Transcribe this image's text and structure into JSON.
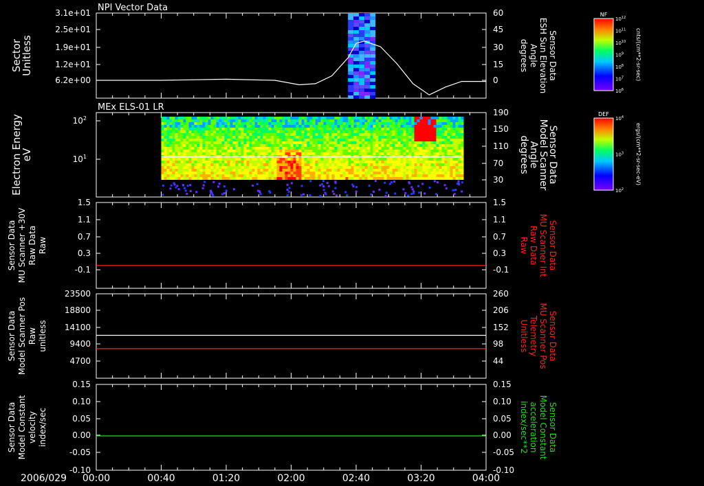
{
  "date_label": "2006/029",
  "time_ticks": [
    "00:00",
    "00:40",
    "01:20",
    "02:00",
    "02:40",
    "03:20",
    "04:00"
  ],
  "colors": {
    "white": "#ffffff",
    "red": "#ff2020",
    "green": "#22dd22",
    "text": "#ffffff"
  },
  "chart_data": [
    {
      "id": "npi",
      "type": "heatmap",
      "title": "NPI Vector Data",
      "left_label": [
        "Sector",
        "Unitless"
      ],
      "right_label": [
        "Sensor Data",
        "ESH Sun Elevation",
        "Angle",
        "degrees"
      ],
      "left_ticks": [
        "3.1e+01",
        "2.5e+01",
        "1.9e+01",
        "1.2e+01",
        "6.2e+00"
      ],
      "right_ticks": [
        "60",
        "45",
        "30",
        "15",
        "0"
      ],
      "xlim": [
        "00:00",
        "04:00"
      ],
      "right_ylim": [
        -15,
        60
      ],
      "colorbar": {
        "label": "NF",
        "units": "cnts/(cm**2-sr-sec)",
        "ticks": [
          "10^12",
          "10^11",
          "10^10",
          "10^9",
          "10^8",
          "10^7",
          "10^6"
        ]
      },
      "heat_time_range": [
        "02:35",
        "02:50"
      ],
      "series": [
        {
          "color": "white",
          "axis": "right",
          "x": [
            "00:00",
            "00:40",
            "01:20",
            "01:50",
            "02:05",
            "02:15",
            "02:25",
            "02:35",
            "02:40",
            "02:45",
            "02:55",
            "03:05",
            "03:15",
            "03:25",
            "03:35",
            "03:45",
            "04:00"
          ],
          "y": [
            0,
            0,
            1,
            0,
            -4,
            -3,
            4,
            20,
            33,
            35,
            30,
            15,
            -3,
            -13,
            -6,
            -1,
            -1
          ]
        }
      ]
    },
    {
      "id": "els",
      "type": "heatmap",
      "title": "MEx ELS-01 LR",
      "left_label": [
        "Electron Energy",
        "eV"
      ],
      "right_label": [
        "Sensor Data",
        "Model Scanner",
        "Angle",
        "degrees"
      ],
      "left_ticks": [
        "10^2",
        "10^1"
      ],
      "right_ticks": [
        "190",
        "150",
        "110",
        "70",
        "30"
      ],
      "right_ylim": [
        0,
        190
      ],
      "colorbar": {
        "label": "DEF",
        "units": "ergs/(cm**2-sr-sec-eV)",
        "ticks": [
          "10^4",
          "10^3",
          "10^2"
        ]
      },
      "heat_time_range": [
        "00:40",
        "03:45"
      ],
      "series": [
        {
          "color": "white",
          "axis": "right",
          "x": [
            "00:40",
            "03:45"
          ],
          "y": [
            90,
            90
          ]
        }
      ]
    },
    {
      "id": "mu_raw",
      "type": "line",
      "left_label": [
        "Sensor Data",
        "MU Scanner +30V",
        "Raw Data",
        "Raw"
      ],
      "right_label": [
        "Sensor Data",
        "MU Scanner Int",
        "Raw Data",
        "Raw"
      ],
      "left_ticks": [
        "1.5",
        "1.1",
        "0.7",
        "0.3",
        "-0.1"
      ],
      "right_ticks": [
        "1.5",
        "1.1",
        "0.7",
        "0.3",
        "-0.1"
      ],
      "ylim": [
        -0.5,
        1.5
      ],
      "series": [
        {
          "color": "red",
          "x": [
            "00:00",
            "04:00"
          ],
          "y": [
            0,
            0
          ]
        }
      ]
    },
    {
      "id": "scanner_pos",
      "type": "line",
      "left_label": [
        "Sensor Data",
        "Model Scanner Pos",
        "Raw",
        "unitless"
      ],
      "right_label": [
        "Sensor Data",
        "MU Scanner Pos",
        "Telemetry",
        "Unitless"
      ],
      "left_ticks": [
        "23500",
        "18800",
        "14100",
        "9400",
        "4700"
      ],
      "right_ticks": [
        "260",
        "206",
        "152",
        "98",
        "44"
      ],
      "ylim": [
        0,
        23500
      ],
      "right_ylim": [
        0,
        260
      ],
      "series": [
        {
          "color": "white",
          "axis": "left",
          "x": [
            "00:00",
            "04:00"
          ],
          "y": [
            11900,
            11900
          ]
        },
        {
          "color": "red",
          "axis": "right",
          "x": [
            "00:00",
            "04:00"
          ],
          "y": [
            84,
            84
          ]
        }
      ]
    },
    {
      "id": "constant",
      "type": "line",
      "left_label": [
        "Sensor Data",
        "Model Constant",
        "velocity",
        "index/sec"
      ],
      "right_label": [
        "Sensor Data",
        "Model Constant",
        "acceleration",
        "index/sec**2"
      ],
      "left_ticks": [
        "0.15",
        "0.10",
        "0.05",
        "0.00",
        "-0.05",
        "-0.10"
      ],
      "right_ticks": [
        "0.15",
        "0.10",
        "0.05",
        "0.00",
        "-0.05",
        "-0.10"
      ],
      "ylim": [
        -0.1,
        0.15
      ],
      "series": [
        {
          "color": "green",
          "x": [
            "00:00",
            "04:00"
          ],
          "y": [
            0,
            0
          ]
        }
      ]
    }
  ]
}
